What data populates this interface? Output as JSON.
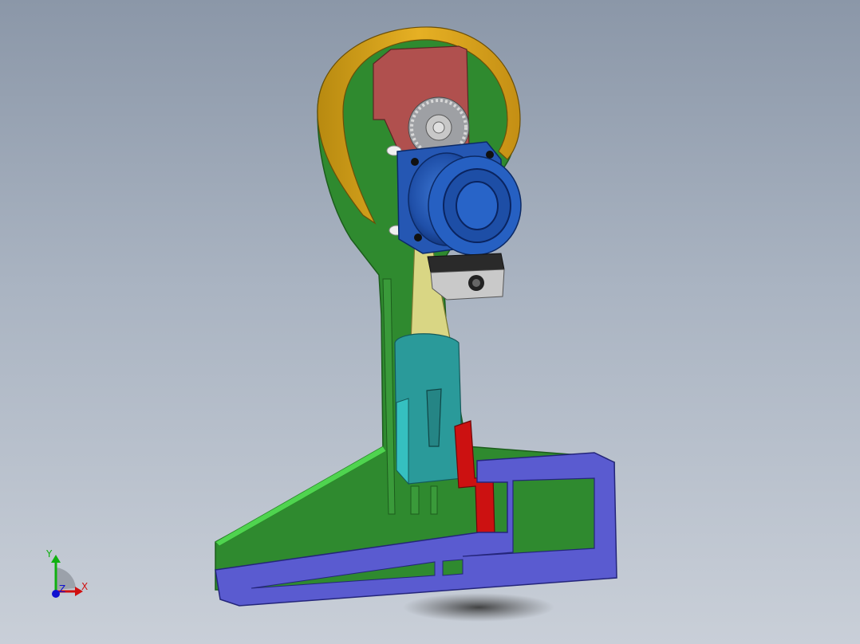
{
  "viewport": {
    "background_top": "#8b97a8",
    "background_bottom": "#c9cfd8"
  },
  "colors": {
    "frame": "#2f8a2f",
    "frame_edge": "#4fd44f",
    "base": "#5a5bd0",
    "guard": "#d8a21a",
    "motor": "#2557b3",
    "coupler": "#2a9a9a",
    "wedge": "#cc1111",
    "rail": "#d9d684",
    "slider_block": "#c9c9c9",
    "pink_block": "#b0504e"
  },
  "triad": {
    "x_label": "X",
    "y_label": "Y",
    "z_label": "Z",
    "x_color": "#d01010",
    "y_color": "#10b010",
    "z_color": "#1010d0"
  }
}
